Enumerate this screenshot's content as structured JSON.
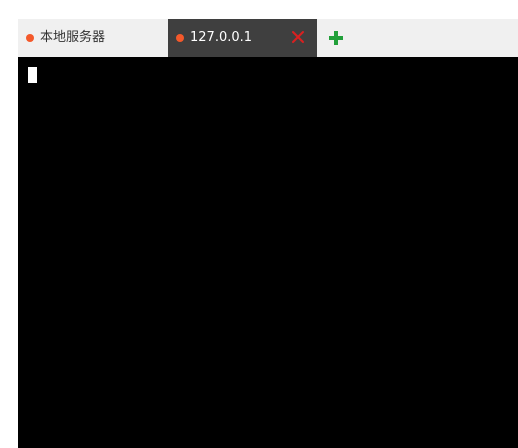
{
  "tabs": [
    {
      "label": "本地服务器",
      "dot_color": "#f4592b",
      "active": false
    },
    {
      "label": "127.0.0.1",
      "dot_color": "#f4592b",
      "active": true
    }
  ],
  "tab_close_icon": "close-icon",
  "add_tab_icon": "plus-icon",
  "colors": {
    "accent_add": "#22a03a",
    "close": "#d92020",
    "terminal_bg": "#000000",
    "active_tab_bg": "#3f3f3f"
  }
}
